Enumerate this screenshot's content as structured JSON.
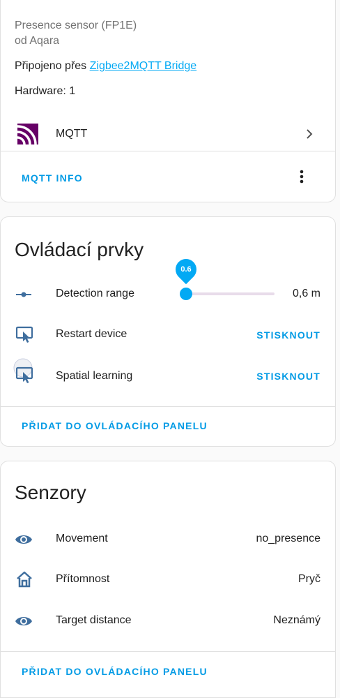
{
  "device_info": {
    "model": "Presence sensor (FP1E)",
    "manufacturer": "od Aqara",
    "connected_prefix": "Připojeno přes ",
    "connected_link": "Zigbee2MQTT Bridge",
    "hardware": "Hardware: 1",
    "integration_label": "MQTT",
    "integration_icon": "mqtt-icon",
    "action_label": "MQTT INFO"
  },
  "controls": {
    "title": "Ovládací prvky",
    "slider": {
      "label": "Detection range",
      "tooltip": "0.6",
      "value_text": "0,6 m",
      "fraction": 0.06
    },
    "buttons": [
      {
        "label": "Restart device",
        "action": "STISKNOUT",
        "icon": "restart-device-icon"
      },
      {
        "label": "Spatial learning",
        "action": "STISKNOUT",
        "icon": "spatial-learning-icon"
      }
    ],
    "add_to_dashboard": "PŘIDAT DO OVLÁDACÍHO PANELU"
  },
  "sensors": {
    "title": "Senzory",
    "items": [
      {
        "label": "Movement",
        "value": "no_presence",
        "icon": "eye-icon"
      },
      {
        "label": "Přítomnost",
        "value": "Pryč",
        "icon": "home-icon"
      },
      {
        "label": "Target distance",
        "value": "Neznámý",
        "icon": "eye-icon"
      }
    ],
    "add_to_dashboard": "PŘIDAT DO OVLÁDACÍHO PANELU"
  },
  "colors": {
    "accent": "#03a9f4",
    "icon_blue": "#3f6e9e",
    "mqtt_purple": "#660066"
  }
}
